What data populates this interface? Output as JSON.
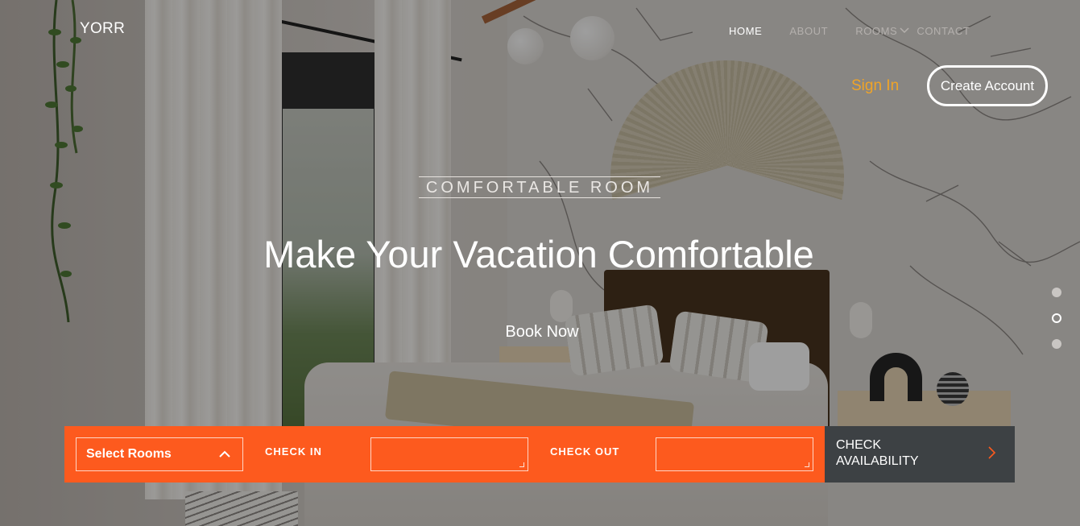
{
  "header": {
    "logo": "YORR",
    "nav": [
      {
        "label": "HOME",
        "active": true
      },
      {
        "label": "ABOUT",
        "active": false
      },
      {
        "label": "ROOMS",
        "active": false,
        "has_dropdown": true
      },
      {
        "label": "CONTACT",
        "active": false
      }
    ],
    "sign_in": "Sign In",
    "create_account": "Create Account"
  },
  "hero": {
    "kicker": "COMFORTABLE ROOM",
    "headline": "Make Your Vacation Comfortable",
    "cta": "Book Now"
  },
  "slider": {
    "slide_count": 3,
    "active_index": 1
  },
  "booking": {
    "select_rooms": "Select Rooms",
    "check_in_label": "CHECK IN",
    "check_in_value": "",
    "check_out_label": "CHECK OUT",
    "check_out_value": "",
    "check_availability": "CHECK AVAILABILITY"
  },
  "colors": {
    "accent_orange": "#fd5a1e",
    "sign_in_gold": "#f0a427",
    "dark_button": "#3d4144"
  },
  "icons": {
    "rooms_dropdown": "chevron-down-icon",
    "select_rooms": "chevron-up-icon",
    "check_availability": "chevron-right-icon"
  }
}
